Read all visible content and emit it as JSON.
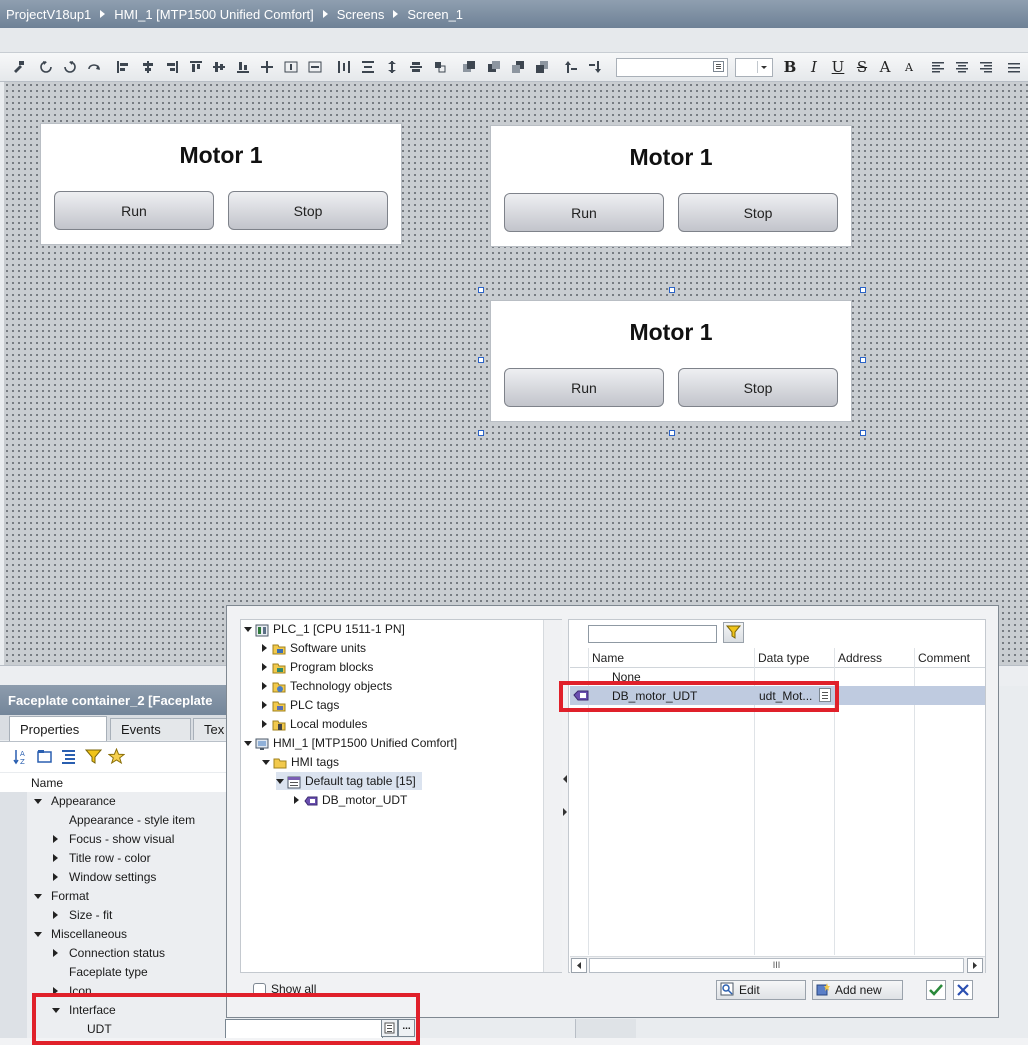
{
  "breadcrumb": [
    "ProjectV18up1",
    "HMI_1 [MTP1500 Unified Comfort]",
    "Screens",
    "Screen_1"
  ],
  "toolbar": {
    "bold": "B",
    "italic": "I",
    "underline": "U",
    "strike": "S",
    "font_grow": "A",
    "font_shrink": "A"
  },
  "canvas": {
    "faceplates": [
      {
        "title": "Motor 1",
        "run": "Run",
        "stop": "Stop"
      },
      {
        "title": "Motor 1",
        "run": "Run",
        "stop": "Stop"
      },
      {
        "title": "Motor 1",
        "run": "Run",
        "stop": "Stop"
      }
    ]
  },
  "inspector": {
    "title": "Faceplate container_2 [Faceplate",
    "tabs": [
      "Properties",
      "Events",
      "Tex"
    ],
    "column_name": "Name",
    "rows": [
      {
        "label": "Appearance",
        "expanded": true
      },
      {
        "label": "Appearance - style item"
      },
      {
        "label": "Focus - show visual",
        "expandable": true
      },
      {
        "label": "Title row - color",
        "expandable": true
      },
      {
        "label": "Window settings",
        "expandable": true
      },
      {
        "label": "Format",
        "expanded": true
      },
      {
        "label": "Size - fit",
        "expandable": true
      },
      {
        "label": "Miscellaneous",
        "expanded": true
      },
      {
        "label": "Connection status",
        "expandable": true
      },
      {
        "label": "Faceplate type"
      },
      {
        "label": "Icon",
        "expandable": true
      },
      {
        "label": "Interface",
        "expanded": true
      },
      {
        "label": "UDT"
      }
    ],
    "udt_value": "",
    "more_button": "..."
  },
  "tag_picker": {
    "tree": [
      "PLC_1 [CPU 1511-1 PN]",
      "Software units",
      "Program blocks",
      "Technology objects",
      "PLC tags",
      "Local modules",
      "HMI_1 [MTP1500 Unified Comfort]",
      "HMI tags",
      "Default tag table [15]",
      "DB_motor_UDT"
    ],
    "filter_value": "",
    "columns": [
      "Name",
      "Data type",
      "Address",
      "Comment"
    ],
    "rows": [
      {
        "name": "None",
        "type": "",
        "address": "",
        "comment": ""
      },
      {
        "name": "DB_motor_UDT",
        "type": "udt_Mot...",
        "address": "",
        "comment": ""
      }
    ],
    "show_all": "Show all",
    "edit": "Edit",
    "add_new": "Add new",
    "scroll_mark": "III"
  },
  "colors": {
    "highlight": "#e0202a",
    "selection_row": "#bfcbe0",
    "title_bar": "#7d8ea2"
  }
}
